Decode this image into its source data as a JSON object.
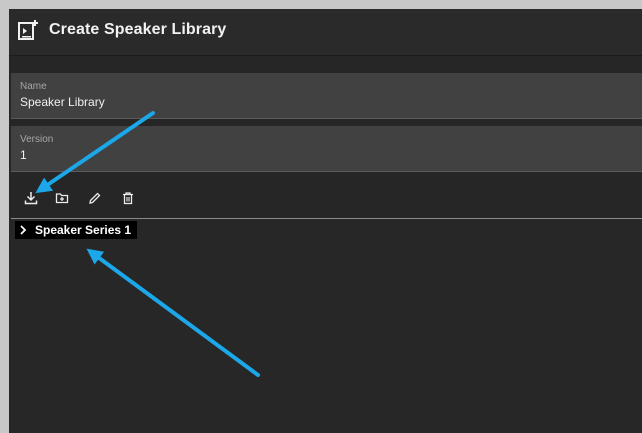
{
  "header": {
    "title": "Create Speaker Library",
    "icon": "add-library-icon"
  },
  "form": {
    "name": {
      "label": "Name",
      "value": "Speaker Library"
    },
    "version": {
      "label": "Version",
      "value": "1"
    }
  },
  "toolbar": {
    "buttons": [
      {
        "icon": "download-icon",
        "name": "download-button"
      },
      {
        "icon": "add-folder-icon",
        "name": "add-folder-button"
      },
      {
        "icon": "pencil-icon",
        "name": "edit-button"
      },
      {
        "icon": "trash-icon",
        "name": "delete-button"
      }
    ]
  },
  "tree": {
    "items": [
      {
        "label": "Speaker Series 1",
        "expanded": false
      }
    ]
  },
  "colors": {
    "background": "#262626",
    "field": "#414141",
    "annotation_arrow": "#1ba7e8",
    "text": "#f0f0f0"
  }
}
